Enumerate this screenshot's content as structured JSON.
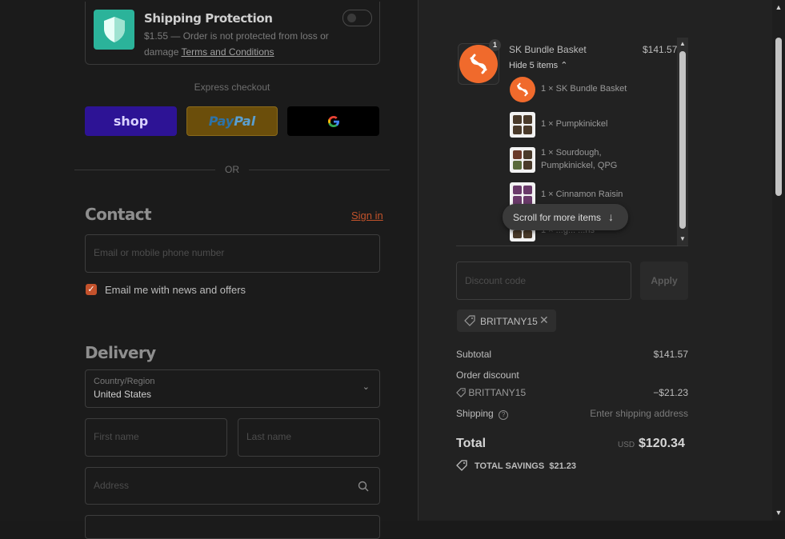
{
  "shipping_protection": {
    "title": "Shipping Protection",
    "description": "$1.55 — Order is not protected from loss or damage",
    "terms_link": "Terms and Conditions",
    "toggle_on": false
  },
  "express_checkout": {
    "label": "Express checkout",
    "shop_label": "shop",
    "paypal_label_1": "Pay",
    "paypal_label_2": "Pal",
    "google_label": "G"
  },
  "or_label": "OR",
  "contact": {
    "heading": "Contact",
    "sign_in": "Sign in",
    "email_placeholder": "Email or mobile phone number",
    "newsletter_label": "Email me with news and offers",
    "newsletter_checked": true
  },
  "delivery": {
    "heading": "Delivery",
    "country_label": "Country/Region",
    "country_value": "United States",
    "first_name_placeholder": "First name",
    "last_name_placeholder": "Last name",
    "address_placeholder": "Address"
  },
  "cart": {
    "quantity_badge": "1",
    "product_name": "SK Bundle Basket",
    "product_price": "$141.57",
    "hide_items": "Hide 5 items",
    "items": [
      {
        "label": "1 × SK Bundle Basket"
      },
      {
        "label": "1 × Pumpkinickel"
      },
      {
        "label_line1": "1 × Sourdough,",
        "label_line2": "Pumpkinickel, QPG"
      },
      {
        "label": "1 × Cinnamon Raisin"
      },
      {
        "label": "1 × ...g... ...ns"
      }
    ],
    "scroll_hint": "Scroll for more items"
  },
  "discount": {
    "placeholder": "Discount code",
    "apply": "Apply",
    "applied_code": "BRITTANY15"
  },
  "summary": {
    "subtotal_label": "Subtotal",
    "subtotal_value": "$141.57",
    "order_discount_label": "Order discount",
    "discount_code": "BRITTANY15",
    "discount_value": "−$21.23",
    "shipping_label": "Shipping",
    "shipping_value": "Enter shipping address",
    "total_label": "Total",
    "currency": "USD",
    "total_value": "$120.34",
    "savings_label": "TOTAL SAVINGS",
    "savings_value": "$21.23"
  },
  "colors": {
    "accent": "#c4522c",
    "shield": "#2bb39a",
    "shop_pay": "#2d1395",
    "paypal": "#6b4e0b",
    "logo_orange": "#f06a2c"
  }
}
